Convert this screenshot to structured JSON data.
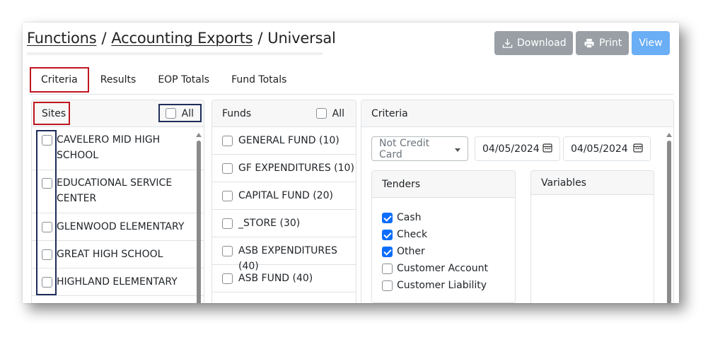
{
  "breadcrumb": {
    "functions": "Functions",
    "sep1": "/",
    "accounting_exports": "Accounting Exports",
    "sep2": "/",
    "current": "Universal"
  },
  "toolbar": {
    "download_label": "Download",
    "print_label": "Print",
    "view_label": "View"
  },
  "tabs": [
    "Criteria",
    "Results",
    "EOP Totals",
    "Fund Totals"
  ],
  "sites": {
    "title": "Sites",
    "all_label": "All",
    "items": [
      [
        "CAVELERO MID HIGH",
        "SCHOOL"
      ],
      [
        "EDUCATIONAL SERVICE",
        "CENTER"
      ],
      [
        "GLENWOOD ELEMENTARY"
      ],
      [
        "GREAT HIGH SCHOOL"
      ],
      [
        "HIGHLAND ELEMENTARY"
      ]
    ]
  },
  "funds": {
    "title": "Funds",
    "all_label": "All",
    "items": [
      "GENERAL FUND (10)",
      "GF EXPENDITURES (10)",
      "CAPITAL FUND (20)",
      "_STORE (30)",
      "ASB EXPENDITURES (40)",
      "ASB FUND (40)"
    ]
  },
  "criteria": {
    "title": "Criteria",
    "payment_filter": "Not Credit Card",
    "date_from": "04/05/2024",
    "date_to": "04/05/2024",
    "tenders": {
      "title": "Tenders",
      "items": [
        {
          "label": "Cash",
          "checked": true
        },
        {
          "label": "Check",
          "checked": true
        },
        {
          "label": "Other",
          "checked": true
        },
        {
          "label": "Customer Account",
          "checked": false
        },
        {
          "label": "Customer Liability",
          "checked": false
        }
      ]
    },
    "variables": {
      "title": "Variables"
    }
  },
  "colors": {
    "highlight_red": "#c0161f",
    "highlight_navy": "#1f2d5a",
    "button_gray": "#999fa5",
    "button_blue": "#6aaef5",
    "checkbox_blue": "#0d6efd"
  }
}
